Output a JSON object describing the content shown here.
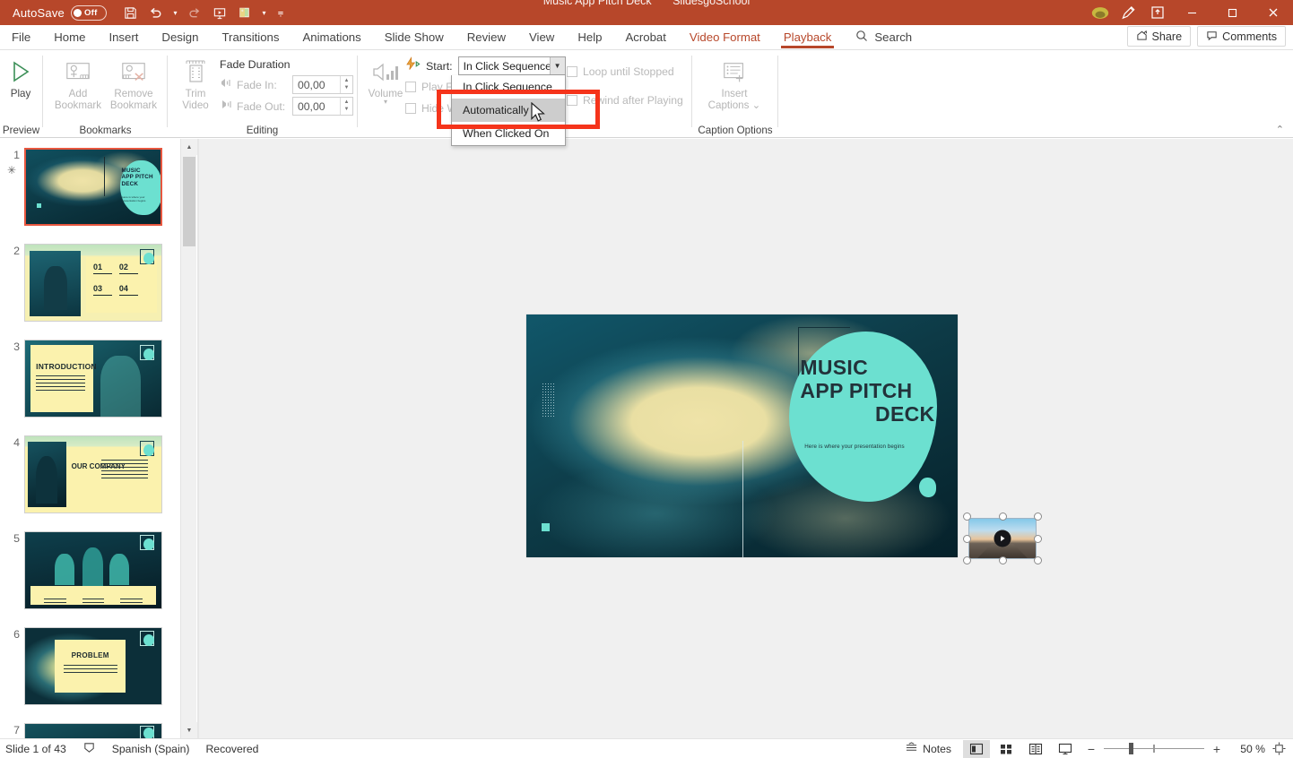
{
  "titlebar": {
    "autosave_label": "AutoSave",
    "autosave_state": "Off",
    "doc_title": "Music App Pitch Deck",
    "doc_subtitle": "SlidesgoSchool",
    "qat": [
      "save-icon",
      "undo-icon",
      "redo-icon",
      "present-icon",
      "start-slideshow-icon",
      "customize-qat-icon"
    ],
    "window": {
      "minimize": "—",
      "maximize": "☐",
      "close": "✕"
    }
  },
  "tabs": [
    {
      "label": "File",
      "active": false
    },
    {
      "label": "Home",
      "active": false
    },
    {
      "label": "Insert",
      "active": false
    },
    {
      "label": "Design",
      "active": false
    },
    {
      "label": "Transitions",
      "active": false
    },
    {
      "label": "Animations",
      "active": false
    },
    {
      "label": "Slide Show",
      "active": false
    },
    {
      "label": "Review",
      "active": false
    },
    {
      "label": "View",
      "active": false
    },
    {
      "label": "Help",
      "active": false
    },
    {
      "label": "Acrobat",
      "active": false
    },
    {
      "label": "Video Format",
      "active": false
    },
    {
      "label": "Playback",
      "active": true
    }
  ],
  "search": {
    "placeholder": "Search",
    "label": "Search"
  },
  "header_actions": {
    "share": "Share",
    "comments": "Comments"
  },
  "ribbon": {
    "groups": [
      {
        "name": "Preview",
        "label": "Preview"
      },
      {
        "name": "Bookmarks",
        "label": "Bookmarks"
      },
      {
        "name": "Editing",
        "label": "Editing"
      },
      {
        "name": "CaptionOptions",
        "label": "Caption Options"
      }
    ],
    "play_button": "Play",
    "add_bookmark": "Add\nBookmark",
    "add_bookmark_l1": "Add",
    "add_bookmark_l2": "Bookmark",
    "remove_bookmark_l1": "Remove",
    "remove_bookmark_l2": "Bookmark",
    "trim_video_l1": "Trim",
    "trim_video_l2": "Video",
    "fade_duration_title": "Fade Duration",
    "fade_in_label": "Fade In:",
    "fade_in_value": "00,00",
    "fade_out_label": "Fade Out:",
    "fade_out_value": "00,00",
    "volume_label": "Volume",
    "start_label": "Start:",
    "start_value": "In Click Sequence",
    "start_options": [
      "In Click Sequence",
      "Automatically",
      "When Clicked On"
    ],
    "start_highlighted_option": "Automatically",
    "checkboxes": [
      {
        "label": "Play Full Screen",
        "checked": false
      },
      {
        "label": "Hide While Not Playing",
        "checked": false
      },
      {
        "label": "Loop until Stopped",
        "checked": false
      },
      {
        "label": "Rewind after Playing",
        "checked": false
      }
    ],
    "insert_captions_l1": "Insert",
    "insert_captions_l2": "Captions"
  },
  "annotation": {
    "color": "#f5341b",
    "target": "Automatically"
  },
  "thumbnails": [
    {
      "number": "1",
      "selected": true,
      "has_animation": true,
      "title": "MUSIC APP PITCH DECK",
      "subtitle": "Here is where your presentation begins"
    },
    {
      "number": "2",
      "selected": false,
      "has_animation": false,
      "items": [
        "01",
        "02",
        "03",
        "04"
      ]
    },
    {
      "number": "3",
      "selected": false,
      "has_animation": false,
      "title": "INTRODUCTION"
    },
    {
      "number": "4",
      "selected": false,
      "has_animation": false,
      "title": "OUR COMPANY"
    },
    {
      "number": "5",
      "selected": false,
      "has_animation": false,
      "title": ""
    },
    {
      "number": "6",
      "selected": false,
      "has_animation": false,
      "title": "PROBLEM"
    },
    {
      "number": "7",
      "selected": false,
      "has_animation": false,
      "title": ""
    }
  ],
  "slide": {
    "title_line1": "MUSIC",
    "title_line2": "APP PITCH",
    "title_line3": "DECK",
    "subtitle": "Here is where your presentation begins",
    "accent_color": "#6ce0d0",
    "bg_dark": "#0d3a46",
    "bg_cream": "#efe3a8"
  },
  "video_object": {
    "name": "video-placeholder",
    "selected": true,
    "play_icon": "play-icon"
  },
  "statusbar": {
    "slide_count": "Slide 1 of 43",
    "accessibility_icon": "accessibility-icon",
    "language": "Spanish (Spain)",
    "recovered": "Recovered",
    "notes": "Notes",
    "views": [
      "normal-view",
      "slide-sorter-view",
      "reading-view",
      "slide-show-view"
    ],
    "active_view": "normal-view",
    "zoom_out": "−",
    "zoom_in": "+",
    "zoom_level": "50 %",
    "fit_slide": "fit-to-window-icon"
  }
}
